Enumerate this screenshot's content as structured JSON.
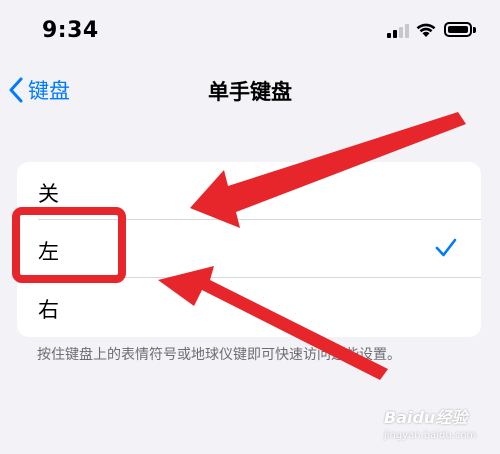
{
  "status_bar": {
    "time": "9:34"
  },
  "nav": {
    "back_label": "键盘",
    "title": "单手键盘"
  },
  "options": [
    {
      "label": "关",
      "selected": false
    },
    {
      "label": "左",
      "selected": true
    },
    {
      "label": "右",
      "selected": false
    }
  ],
  "footer_note": "按住键盘上的表情符号或地球仪键即可快速访问这些设置。",
  "colors": {
    "accent": "#007aff",
    "annotation": "#e6262b",
    "background": "#f2f2f7"
  },
  "watermark": {
    "main": "Baidu经验",
    "sub": "jingyan.baidu.com"
  }
}
